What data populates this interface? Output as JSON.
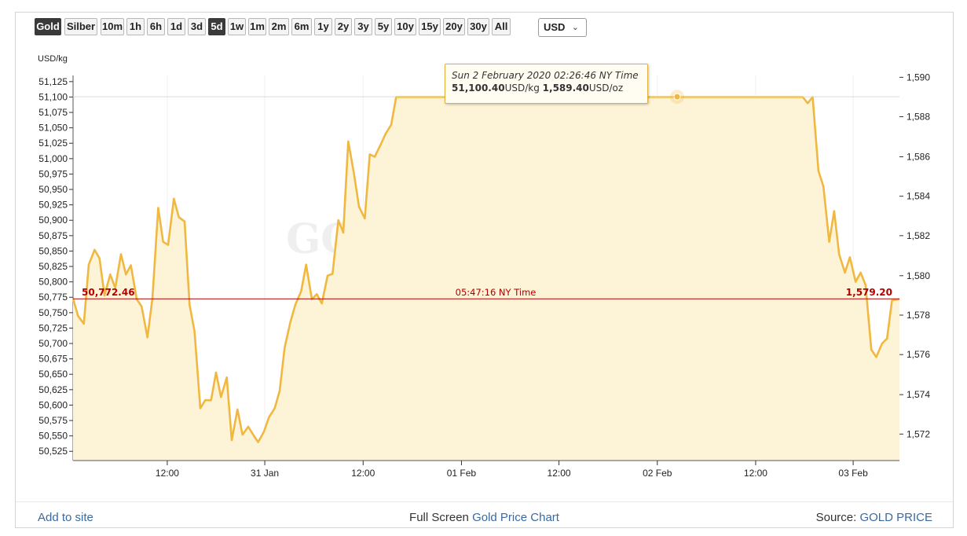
{
  "toolbar": {
    "buttons": [
      {
        "label": "Gold",
        "active": true
      },
      {
        "label": "Silber",
        "active": false
      },
      {
        "label": "10m",
        "active": false
      },
      {
        "label": "1h",
        "active": false
      },
      {
        "label": "6h",
        "active": false
      },
      {
        "label": "1d",
        "active": false
      },
      {
        "label": "3d",
        "active": false
      },
      {
        "label": "5d",
        "active": true
      },
      {
        "label": "1w",
        "active": false
      },
      {
        "label": "1m",
        "active": false
      },
      {
        "label": "2m",
        "active": false
      },
      {
        "label": "6m",
        "active": false
      },
      {
        "label": "1y",
        "active": false
      },
      {
        "label": "2y",
        "active": false
      },
      {
        "label": "3y",
        "active": false
      },
      {
        "label": "5y",
        "active": false
      },
      {
        "label": "10y",
        "active": false
      },
      {
        "label": "15y",
        "active": false
      },
      {
        "label": "20y",
        "active": false
      },
      {
        "label": "30y",
        "active": false
      },
      {
        "label": "All",
        "active": false
      }
    ],
    "currency": "USD",
    "chevron_icon": "chevron-down-icon"
  },
  "tooltip": {
    "date": "Sun 2 February 2020 02:26:46 NY Time",
    "kg_value": "51,100.40",
    "kg_unit": "USD/kg",
    "oz_value": "1,589.40",
    "oz_unit": "USD/oz"
  },
  "footer": {
    "add_to_site": "Add to site",
    "full_screen_prefix": "Full Screen",
    "full_screen_link": "Gold Price Chart",
    "source_prefix": "Source:",
    "source_link": "GOLD PRICE"
  },
  "watermark": "GOLDPRICE.ORG",
  "colors": {
    "line": "#f0b840",
    "fill": "#fdf3d6",
    "current": "#b30000",
    "active_button": "#3a3a3a",
    "link": "#3a6aa0"
  },
  "chart_data": {
    "type": "area",
    "left_axis_label": "USD/kg",
    "ylim_left": [
      50510,
      51135
    ],
    "yticks_left": [
      "51,125",
      "51,100",
      "51,075",
      "51,050",
      "51,025",
      "51,000",
      "50,975",
      "50,950",
      "50,925",
      "50,900",
      "50,875",
      "50,850",
      "50,825",
      "50,800",
      "50,775",
      "50,750",
      "50,725",
      "50,700",
      "50,675",
      "50,650",
      "50,625",
      "50,600",
      "50,575",
      "50,550",
      "50,525"
    ],
    "yticks_right": [
      {
        "label": "1,590",
        "kg": 51132
      },
      {
        "label": "1,588",
        "kg": 51068
      },
      {
        "label": "1,586",
        "kg": 51003
      },
      {
        "label": "1,584",
        "kg": 50939
      },
      {
        "label": "1,582",
        "kg": 50875
      },
      {
        "label": "1,580",
        "kg": 50810
      },
      {
        "label": "1,578",
        "kg": 50746
      },
      {
        "label": "1,576",
        "kg": 50682
      },
      {
        "label": "1,574",
        "kg": 50617
      },
      {
        "label": "1,572",
        "kg": 50553
      }
    ],
    "xlim": [
      0,
      100
    ],
    "xticks": [
      {
        "label": "12:00",
        "x": 11.4
      },
      {
        "label": "31 Jan",
        "x": 23.2
      },
      {
        "label": "12:00",
        "x": 35.1
      },
      {
        "label": "01 Feb",
        "x": 47.0
      },
      {
        "label": "12:00",
        "x": 58.8
      },
      {
        "label": "02 Feb",
        "x": 70.7
      },
      {
        "label": "12:00",
        "x": 82.6
      },
      {
        "label": "03 Feb",
        "x": 94.4
      }
    ],
    "current_value_kg": "50,772.46",
    "current_value_oz": "1,579.20",
    "current_level": 50772.46,
    "current_time": "05:47:16 NY Time",
    "highlight": {
      "x": 73.1,
      "y": 51100.4
    },
    "series": [
      {
        "values": [
          [
            0,
            50773
          ],
          [
            0.6,
            50745
          ],
          [
            1.3,
            50732
          ],
          [
            1.9,
            50828
          ],
          [
            2.6,
            50852
          ],
          [
            3.2,
            50838
          ],
          [
            3.8,
            50778
          ],
          [
            4.5,
            50812
          ],
          [
            5.1,
            50790
          ],
          [
            5.8,
            50845
          ],
          [
            6.4,
            50812
          ],
          [
            7.0,
            50827
          ],
          [
            7.7,
            50772
          ],
          [
            8.3,
            50760
          ],
          [
            9.0,
            50710
          ],
          [
            9.6,
            50773
          ],
          [
            10.3,
            50920
          ],
          [
            10.9,
            50865
          ],
          [
            11.5,
            50860
          ],
          [
            12.2,
            50935
          ],
          [
            12.8,
            50905
          ],
          [
            13.5,
            50898
          ],
          [
            14.1,
            50763
          ],
          [
            14.7,
            50720
          ],
          [
            15.4,
            50595
          ],
          [
            16.0,
            50608
          ],
          [
            16.7,
            50608
          ],
          [
            17.3,
            50653
          ],
          [
            17.9,
            50613
          ],
          [
            18.6,
            50645
          ],
          [
            19.2,
            50543
          ],
          [
            19.9,
            50593
          ],
          [
            20.5,
            50552
          ],
          [
            21.2,
            50565
          ],
          [
            21.8,
            50552
          ],
          [
            22.4,
            50540
          ],
          [
            23.1,
            50557
          ],
          [
            23.7,
            50580
          ],
          [
            24.4,
            50595
          ],
          [
            25.0,
            50623
          ],
          [
            25.6,
            50693
          ],
          [
            26.3,
            50735
          ],
          [
            26.9,
            50763
          ],
          [
            27.6,
            50785
          ],
          [
            28.2,
            50828
          ],
          [
            28.9,
            50772
          ],
          [
            29.5,
            50780
          ],
          [
            30.1,
            50765
          ],
          [
            30.8,
            50810
          ],
          [
            31.4,
            50813
          ],
          [
            32.1,
            50900
          ],
          [
            32.7,
            50880
          ],
          [
            33.3,
            51028
          ],
          [
            34.0,
            50975
          ],
          [
            34.6,
            50922
          ],
          [
            35.3,
            50903
          ],
          [
            35.9,
            51007
          ],
          [
            36.5,
            51003
          ],
          [
            37.2,
            51022
          ],
          [
            37.8,
            51040
          ],
          [
            38.5,
            51055
          ],
          [
            39.1,
            51100
          ],
          [
            88.3,
            51100
          ],
          [
            88.9,
            51090
          ],
          [
            89.5,
            51100
          ],
          [
            90.2,
            50980
          ],
          [
            90.8,
            50955
          ],
          [
            91.5,
            50865
          ],
          [
            92.1,
            50915
          ],
          [
            92.7,
            50845
          ],
          [
            93.4,
            50815
          ],
          [
            94.0,
            50840
          ],
          [
            94.7,
            50800
          ],
          [
            95.3,
            50815
          ],
          [
            95.9,
            50795
          ],
          [
            96.6,
            50690
          ],
          [
            97.2,
            50678
          ],
          [
            97.9,
            50700
          ],
          [
            98.5,
            50708
          ],
          [
            99.1,
            50770
          ],
          [
            100,
            50772
          ]
        ]
      }
    ]
  }
}
